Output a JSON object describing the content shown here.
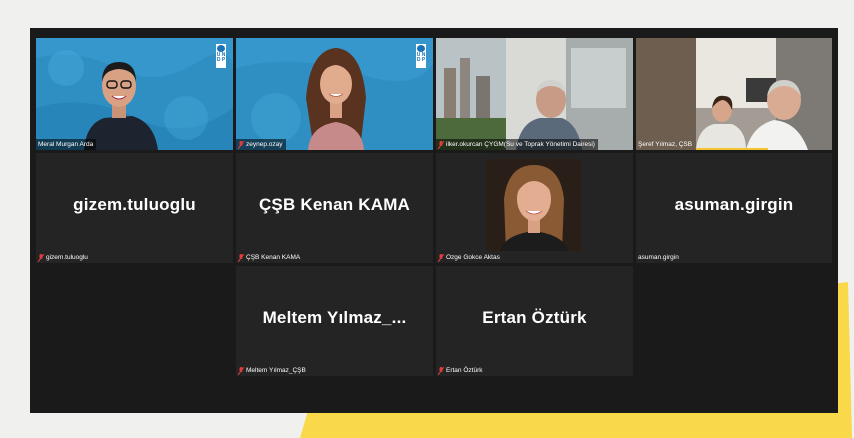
{
  "participants": [
    {
      "display_name": "Meral Muratgan Arda",
      "label": "Meral Murgan Arda",
      "video": true,
      "active_speaker": true,
      "muted": false
    },
    {
      "display_name": "zeynep.ozay",
      "label": "zeynep.ozay",
      "video": true,
      "muted": true
    },
    {
      "display_name": "ilker.okurcan",
      "label": "ilker.okurcan ÇYGM(Su ve Toprak Yönetimi Dairesi)",
      "video": true,
      "muted": true
    },
    {
      "display_name": "Şeref Yılmaz, ÇSB",
      "label": "Şeref Yılmaz, ÇSB",
      "video": true,
      "muted": false
    },
    {
      "display_name": "gizem.tuluoglu",
      "label": "gizem.tuluoglu",
      "video": false,
      "muted": true
    },
    {
      "display_name": "ÇŞB Kenan KAMA",
      "label": "ÇŞB Kenan KAMA",
      "video": false,
      "muted": true
    },
    {
      "display_name": "Ozge Gokce Aktas",
      "label": "Ozge Gokce Aktas",
      "video": true,
      "muted": true
    },
    {
      "display_name": "asuman.girgin",
      "label": "asuman.girgin",
      "video": false,
      "muted": false
    },
    {
      "display_name": "Meltem Yılmaz_...",
      "label": "Meltem Yılmaz_ÇŞB",
      "video": false,
      "muted": true
    },
    {
      "display_name": "Ertan Öztürk",
      "label": "Ertan Öztürk",
      "video": false,
      "muted": true
    }
  ],
  "logo_text": "U N D P",
  "colors": {
    "active_border": "#c9e265",
    "mic_muted": "#e03c3c",
    "tile_bg": "#242424",
    "deco_yellow": "#f9d84a"
  }
}
